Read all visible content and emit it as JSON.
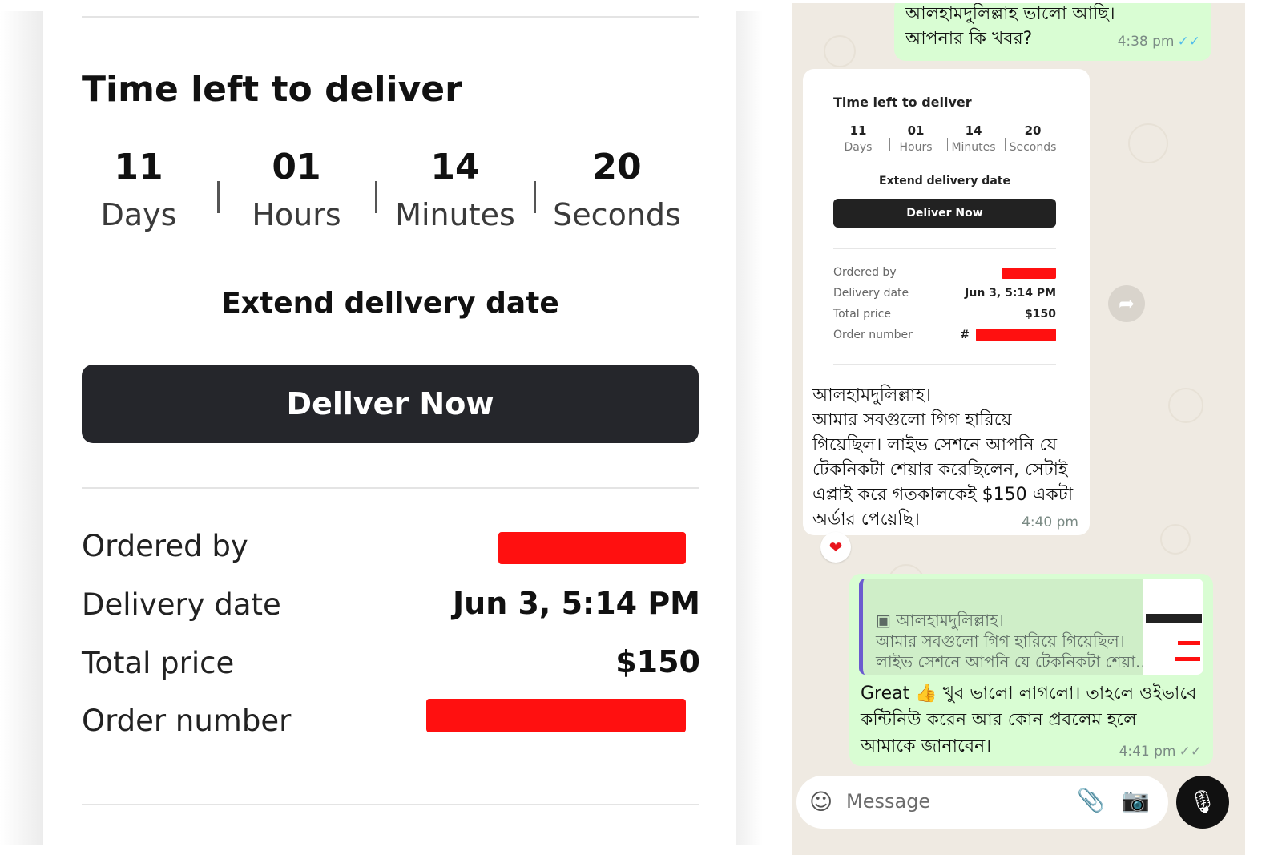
{
  "order_panel": {
    "title": "Time left to deliver",
    "countdown": [
      {
        "value": "11",
        "unit": "Days"
      },
      {
        "value": "01",
        "unit": "Hours"
      },
      {
        "value": "14",
        "unit": "Minutes"
      },
      {
        "value": "20",
        "unit": "Seconds"
      }
    ],
    "extend_label": "Extend dellvery date",
    "deliver_button": "Dellver Now",
    "details": [
      {
        "label": "Ordered by",
        "value": ""
      },
      {
        "label": "Delivery date",
        "value": "Jun 3, 5:14 PM"
      },
      {
        "label": "Total price",
        "value": "$150"
      },
      {
        "label": "Order number",
        "value": "#"
      }
    ],
    "redaction_color": "#ff1010"
  },
  "chat": {
    "messages": [
      {
        "direction": "outgoing",
        "lines": [
          "আলহামদুলিল্লাহ ভালো আছি।",
          "আপনার কি খবর?"
        ],
        "time": "4:38 pm",
        "status": "read"
      },
      {
        "direction": "incoming",
        "attachment": {
          "title": "Time left to deliver",
          "countdown": [
            {
              "value": "11",
              "unit": "Days"
            },
            {
              "value": "01",
              "unit": "Hours"
            },
            {
              "value": "14",
              "unit": "Minutes"
            },
            {
              "value": "20",
              "unit": "Seconds"
            }
          ],
          "extend_label": "Extend delivery date",
          "deliver_button": "Deliver Now",
          "details": [
            {
              "label": "Ordered by",
              "value": ""
            },
            {
              "label": "Delivery date",
              "value": "Jun 3, 5:14 PM"
            },
            {
              "label": "Total price",
              "value": "$150"
            },
            {
              "label": "Order number",
              "value": "#"
            }
          ]
        },
        "lines": [
          "আলহামদুলিল্লাহ।",
          "আমার সবগুলো গিগ হারিয়ে",
          "গিয়েছিল। লাইভ সেশনে আপনি যে",
          "টেকনিকটা শেয়ার করেছিলেন, সেটাই",
          "এপ্লাই করে গতকালকেই $150 একটা",
          "অর্ডার পেয়েছি।"
        ],
        "time": "4:40 pm",
        "reaction": "❤"
      },
      {
        "direction": "outgoing",
        "quote_lines": [
          "আলহামদুলিল্লাহ।",
          "আমার সবগুলো গিগ হারিয়ে গিয়েছিল।",
          "লাইভ সেশনে আপনি যে টেকনিকটা শেয়া..."
        ],
        "lines": [
          "Great 👍 খুব ভালো লাগলো। তাহলে ওইভাবে",
          "কন্টিনিউ করেন আর কোন প্রবলেম হলে",
          "আমাকে জানাবেন।"
        ],
        "time": "4:41 pm",
        "status": "delivered"
      }
    ],
    "input_placeholder": "Message",
    "colors": {
      "background": "#efeae2",
      "outgoing_bubble": "#d9fdd3",
      "incoming_bubble": "#ffffff",
      "read_ticks": "#53bdeb"
    }
  }
}
